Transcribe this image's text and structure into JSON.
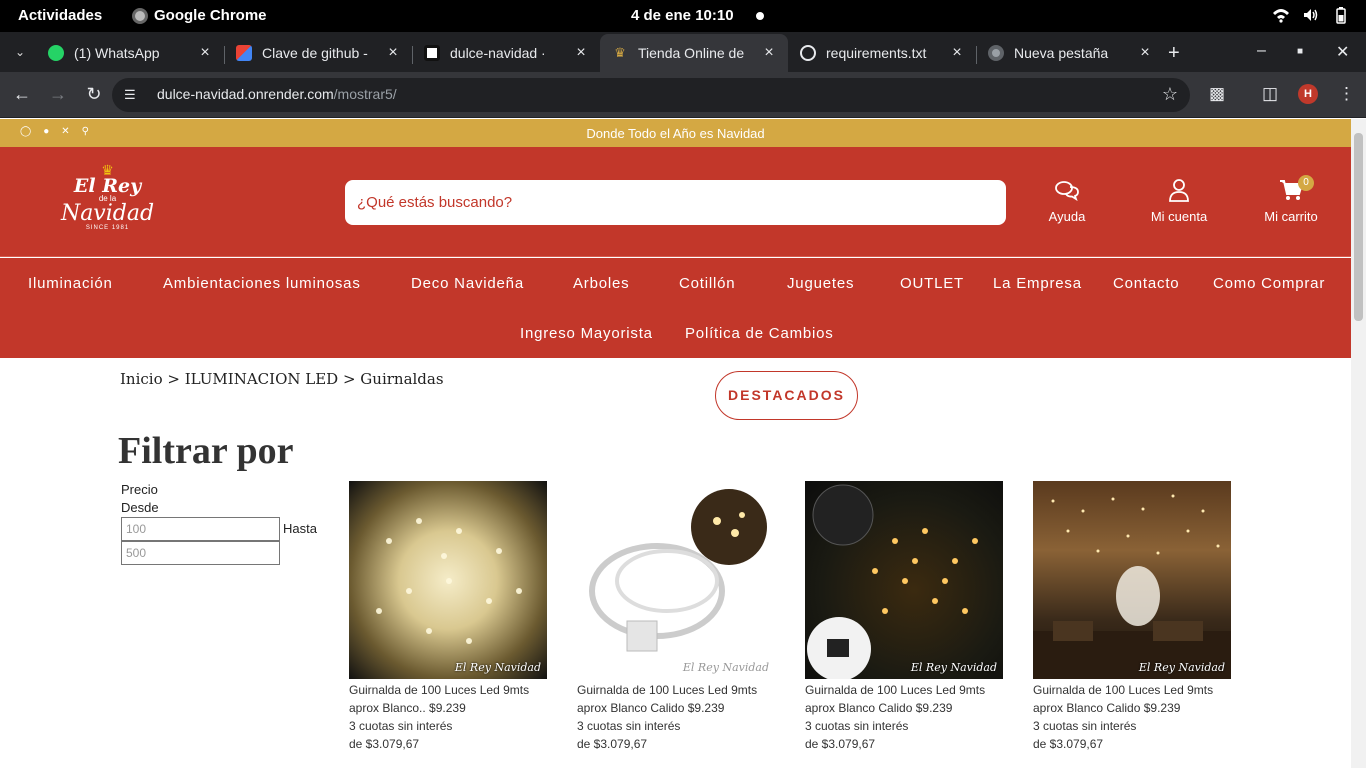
{
  "system": {
    "activities": "Actividades",
    "app_name": "Google Chrome",
    "clock": "4 de ene  10:10"
  },
  "tabs": [
    {
      "title": "(1) WhatsApp",
      "icon": "whatsapp-icon",
      "color": "#25d366"
    },
    {
      "title": "Clave de github -",
      "icon": "gmail-icon",
      "color": "#ea4335"
    },
    {
      "title": "dulce-navidad · ",
      "icon": "render-icon",
      "color": "#ffffff"
    },
    {
      "title": "Tienda Online de",
      "icon": "crown-icon",
      "color": "#d4a843"
    },
    {
      "title": "requirements.txt",
      "icon": "github-icon",
      "color": "#ffffff"
    },
    {
      "title": "Nueva pestaña",
      "icon": "chrome-icon",
      "color": "#9aa0a6"
    }
  ],
  "toolbar": {
    "url_host": "dulce-navidad.onrender.com",
    "url_path": "/mostrar5/",
    "profile_initial": "H"
  },
  "site": {
    "promo_text": "Donde Todo el Año es Navidad",
    "social": [
      "instagram-icon",
      "facebook-icon",
      "x-icon",
      "pinterest-icon"
    ],
    "logo": {
      "line1": "El Rey",
      "line2": "de la",
      "line3": "Navidad",
      "line4": "SINCE 1981"
    },
    "search_placeholder": "¿Qué estás buscando?",
    "header_buttons": {
      "help": "Ayuda",
      "account": "Mi cuenta",
      "cart": "Mi carrito",
      "cart_count": "0"
    },
    "menu": [
      "Iluminación",
      "Ambientaciones luminosas",
      "Deco Navideña",
      "Arboles",
      "Cotillón",
      "Juguetes",
      "OUTLET",
      "La Empresa",
      "Contacto",
      "Como Comprar",
      "Ingreso Mayorista",
      "Política de Cambios"
    ],
    "breadcrumb": "Inicio > ILUMINACION LED > Guirnaldas",
    "destacados": "DESTACADOS",
    "filter": {
      "title": "Filtrar por",
      "price_label": "Precio",
      "from_label": "Desde",
      "to_label": "Hasta",
      "from_placeholder": "100",
      "to_placeholder": "500"
    },
    "products": [
      {
        "name": "Guirnalda de 100 Luces Led 9mts aprox Blanco.. $9.239",
        "installments": "3 cuotas sin interés",
        "installment_price": "de $3.079,67"
      },
      {
        "name": "Guirnalda de 100 Luces Led 9mts aprox Blanco Calido $9.239",
        "installments": "3 cuotas sin interés",
        "installment_price": "de $3.079,67"
      },
      {
        "name": "Guirnalda de 100 Luces Led 9mts aprox Blanco Calido $9.239",
        "installments": "3 cuotas sin interés",
        "installment_price": "de $3.079,67"
      },
      {
        "name": "Guirnalda de 100 Luces Led 9mts aprox Blanco Calido $9.239",
        "installments": "3 cuotas sin interés",
        "installment_price": "de $3.079,67"
      }
    ],
    "watermark": "El Rey Navidad"
  },
  "colors": {
    "brand_red": "#c2372a",
    "brand_gold": "#d4a843"
  }
}
